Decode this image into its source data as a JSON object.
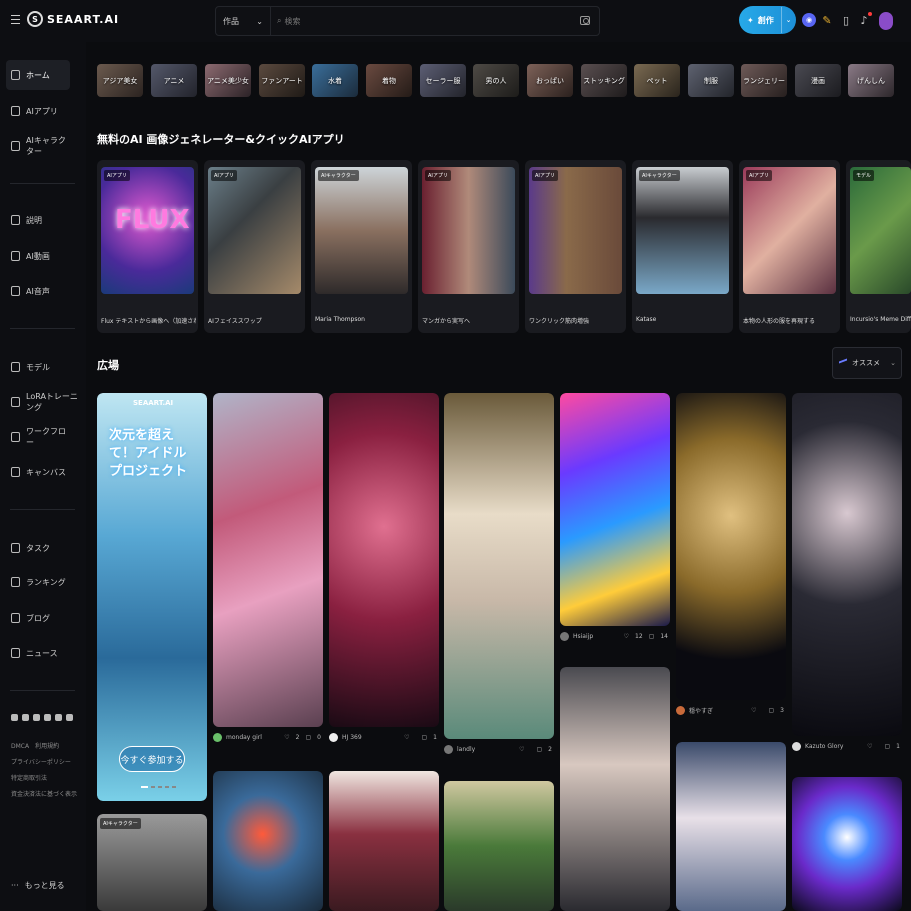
{
  "header": {
    "logo_text": "SEAART.AI",
    "search_type": "作品",
    "search_placeholder": "検索",
    "create_label": "創作"
  },
  "sidebar": {
    "items": [
      {
        "label": "ホーム",
        "icon": "home-icon",
        "active": true
      },
      {
        "label": "AIアプリ",
        "icon": "app-icon"
      },
      {
        "label": "AIキャラクター",
        "icon": "character-icon"
      },
      {
        "label": "説明",
        "icon": "doc-icon"
      },
      {
        "label": "AI動画",
        "icon": "video-icon"
      },
      {
        "label": "AI音声",
        "icon": "audio-icon"
      },
      {
        "label": "モデル",
        "icon": "model-icon"
      },
      {
        "label": "LoRAトレーニング",
        "icon": "lora-icon"
      },
      {
        "label": "ワークフロー",
        "icon": "workflow-icon"
      },
      {
        "label": "キャンバス",
        "icon": "canvas-icon"
      },
      {
        "label": "タスク",
        "icon": "task-icon"
      },
      {
        "label": "ランキング",
        "icon": "ranking-icon"
      },
      {
        "label": "ブログ",
        "icon": "blog-icon"
      },
      {
        "label": "ニュース",
        "icon": "news-icon"
      }
    ],
    "footer_links": [
      "DMCA　利用規約",
      "プライバシーポリシー",
      "特定商取引法",
      "資金決済法に基づく表示"
    ],
    "more_label": "もっと見る"
  },
  "categories": [
    "アジア美女",
    "アニメ",
    "アニメ美少女",
    "ファンアート",
    "水着",
    "着物",
    "セーラー服",
    "男の人",
    "おっぱい",
    "ストッキング",
    "ペット",
    "制服",
    "ランジェリー",
    "漫画",
    "げんしん"
  ],
  "apps_section": {
    "title": "無料のAI 画像ジェネレーター&クイックAIアプリ",
    "cards": [
      {
        "tag": "AIアプリ",
        "label": "Flux テキストから画像へ（加速された）"
      },
      {
        "tag": "AIアプリ",
        "label": "AIフェイススワップ"
      },
      {
        "tag": "AIキャラクター",
        "label": "Maria Thompson"
      },
      {
        "tag": "AIアプリ",
        "label": "マンガから実写へ"
      },
      {
        "tag": "AIアプリ",
        "label": "ワンクリック筋肉増強"
      },
      {
        "tag": "AIキャラクター",
        "label": "Katase"
      },
      {
        "tag": "AIアプリ",
        "label": "本物の人形の服を再現する"
      },
      {
        "tag": "モデル",
        "label": "Incursio's Meme Diffusion"
      }
    ]
  },
  "plaza": {
    "title": "広場",
    "sort_label": "オススメ",
    "ad": {
      "logo": "SEAART.AI",
      "headline": "次元を超えて！アイドルプロジェクト",
      "button": "今すぐ参加する"
    },
    "ad2_tag": "AIキャラクター",
    "cards": [
      {
        "user": "monday girl",
        "likes": "2",
        "comments": "0"
      },
      {
        "user": "HJ 369",
        "likes": "",
        "comments": "1"
      },
      {
        "user": "landly",
        "likes": "",
        "comments": "2"
      },
      {
        "user": "Hsiaijp",
        "likes": "12",
        "comments": "14"
      },
      {
        "user": "穏やすぎ",
        "likes": "",
        "comments": "3"
      },
      {
        "user": "Kazuto Glory",
        "likes": "",
        "comments": "1"
      }
    ]
  }
}
